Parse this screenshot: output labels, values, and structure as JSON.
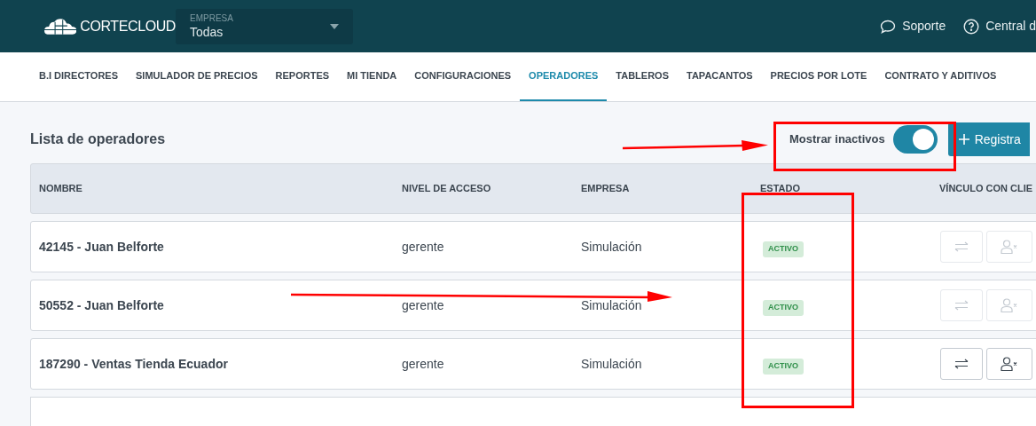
{
  "header": {
    "logo": "CORTECLOUD",
    "company_select": {
      "label": "EMPRESA",
      "value": "Todas"
    },
    "links": [
      {
        "kind": "chat",
        "label": "Soporte"
      },
      {
        "kind": "help",
        "label": "Central d"
      }
    ]
  },
  "nav": [
    {
      "label": "B.I DIRECTORES",
      "selected": false
    },
    {
      "label": "SIMULADOR DE PRECIOS",
      "selected": false
    },
    {
      "label": "REPORTES",
      "selected": false
    },
    {
      "label": "MI TIENDA",
      "selected": false
    },
    {
      "label": "CONFIGURACIONES",
      "selected": false
    },
    {
      "label": "OPERADORES",
      "selected": true
    },
    {
      "label": "TABLEROS",
      "selected": false
    },
    {
      "label": "TAPACANTOS",
      "selected": false
    },
    {
      "label": "PRECIOS POR LOTE",
      "selected": false
    },
    {
      "label": "CONTRATO Y ADITIVOS",
      "selected": false
    }
  ],
  "page": {
    "title": "Lista de operadores",
    "toggle": {
      "label": "Mostrar inactivos",
      "on": true
    },
    "register_button": "Registra"
  },
  "table": {
    "columns": [
      "NOMBRE",
      "NIVEL DE ACCESO",
      "EMPRESA",
      "ESTADO",
      "VÍNCULO CON CLIE"
    ],
    "rows": [
      {
        "name": "42145 - Juan Belforte",
        "level": "gerente",
        "company": "Simulación",
        "status": "ACTIVO",
        "actions_disabled": true
      },
      {
        "name": "50552 - Juan Belforte",
        "level": "gerente",
        "company": "Simulación",
        "status": "ACTIVO",
        "actions_disabled": true
      },
      {
        "name": "187290 - Ventas Tienda Ecuador",
        "level": "gerente",
        "company": "Simulación",
        "status": "ACTIVO",
        "actions_disabled": false
      }
    ]
  }
}
